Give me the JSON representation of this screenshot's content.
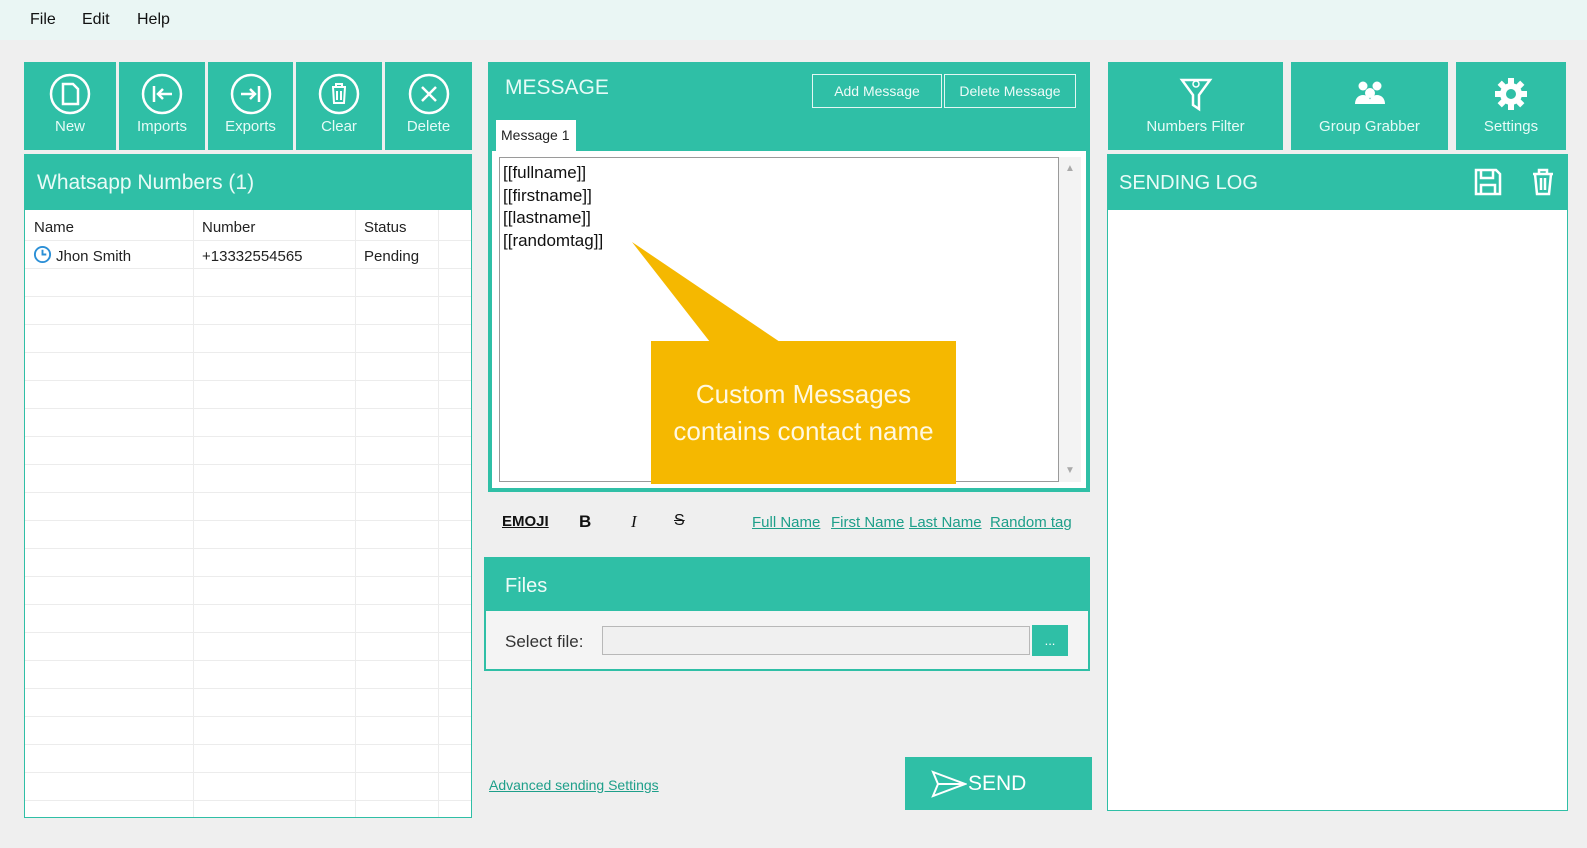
{
  "menu": {
    "file": "File",
    "edit": "Edit",
    "help": "Help"
  },
  "toolbar": [
    {
      "label": "New",
      "icon": "new-file-icon"
    },
    {
      "label": "Imports",
      "icon": "import-icon"
    },
    {
      "label": "Exports",
      "icon": "export-icon"
    },
    {
      "label": "Clear",
      "icon": "trash-icon"
    },
    {
      "label": "Delete",
      "icon": "close-circle-icon"
    }
  ],
  "numbers_panel": {
    "title": "Whatsapp Numbers (1)",
    "columns": [
      "Name",
      "Number",
      "Status"
    ],
    "rows": [
      {
        "name": "Jhon Smith",
        "number": "+13332554565",
        "status": "Pending"
      }
    ]
  },
  "message": {
    "title": "MESSAGE",
    "add_label": "Add Message",
    "delete_label": "Delete Message",
    "tab": "Message 1",
    "lines": [
      "[[fullname]]",
      "[[firstname]]",
      "[[lastname]]",
      "[[randomtag]]"
    ],
    "callout": [
      "Custom Messages",
      "contains contact name"
    ]
  },
  "format": {
    "emoji": "EMOJI",
    "bold": "B",
    "italic": "I",
    "strike": "S",
    "links": [
      "Full Name",
      "First Name",
      "Last Name",
      "Random tag"
    ]
  },
  "files": {
    "title": "Files",
    "label": "Select file:",
    "browse": "...",
    "value": ""
  },
  "advanced": "Advanced sending Settings",
  "send": "SEND",
  "right_toolbar": [
    {
      "label": "Numbers Filter",
      "icon": "funnel-icon"
    },
    {
      "label": "Group Grabber",
      "icon": "group-icon"
    },
    {
      "label": "Settings",
      "icon": "gear-icon"
    }
  ],
  "log": {
    "title": "SENDING LOG"
  },
  "colors": {
    "accent": "#2fbfa6",
    "callout": "#f5b800"
  }
}
